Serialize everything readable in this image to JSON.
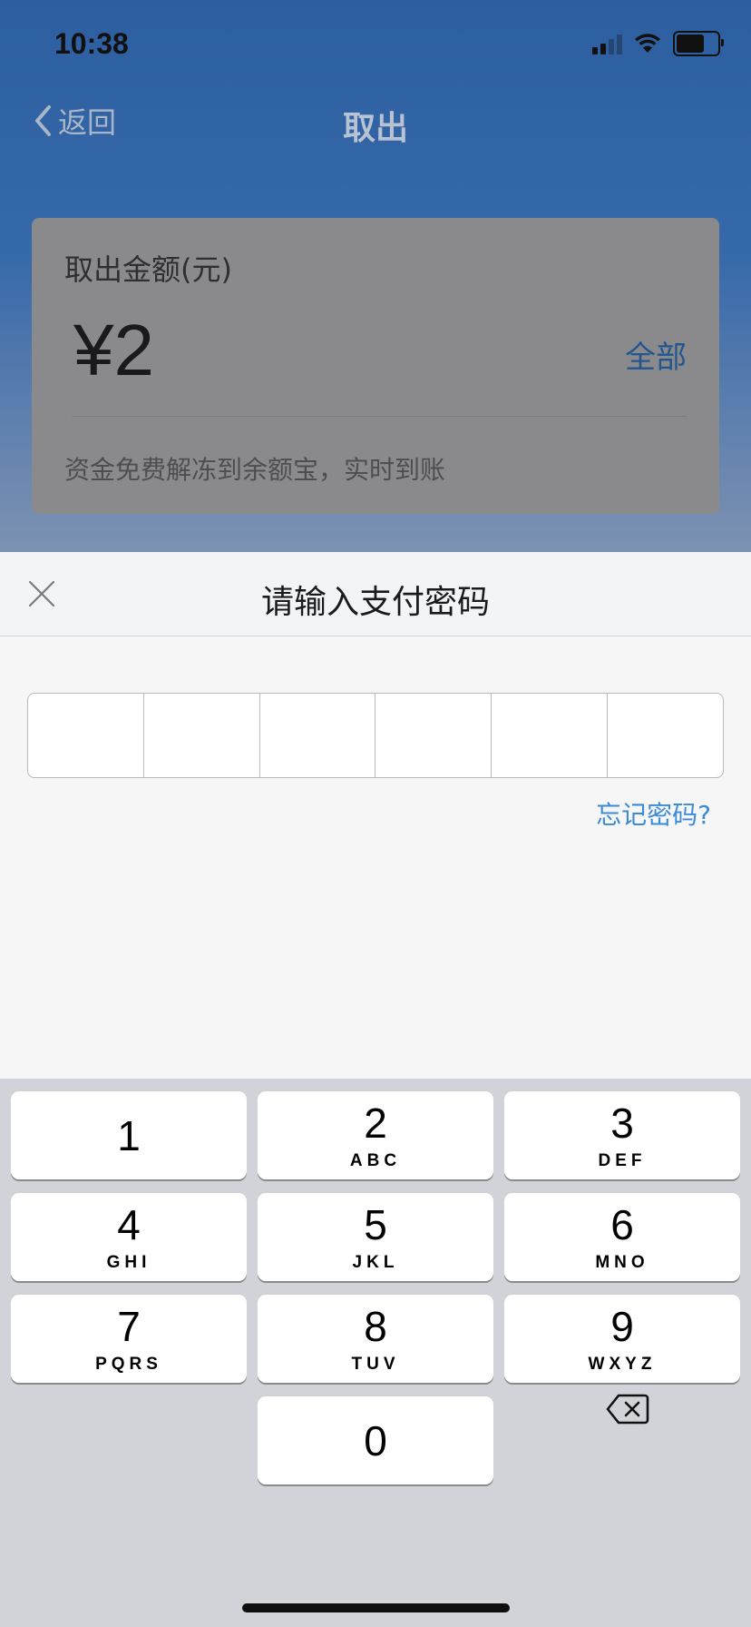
{
  "status_bar": {
    "time": "10:38"
  },
  "nav": {
    "back_label": "返回",
    "title": "取出"
  },
  "amount_card": {
    "label": "取出金额(元)",
    "value": "¥2",
    "all_label": "全部",
    "hint": "资金免费解冻到余额宝，实时到账"
  },
  "password_sheet": {
    "title": "请输入支付密码",
    "forgot_label": "忘记密码?",
    "digit_count": 6
  },
  "keypad": {
    "keys": [
      {
        "num": "1",
        "letters": ""
      },
      {
        "num": "2",
        "letters": "ABC"
      },
      {
        "num": "3",
        "letters": "DEF"
      },
      {
        "num": "4",
        "letters": "GHI"
      },
      {
        "num": "5",
        "letters": "JKL"
      },
      {
        "num": "6",
        "letters": "MNO"
      },
      {
        "num": "7",
        "letters": "PQRS"
      },
      {
        "num": "8",
        "letters": "TUV"
      },
      {
        "num": "9",
        "letters": "WXYZ"
      },
      {
        "num": "0",
        "letters": ""
      }
    ],
    "delete_icon": "backspace-icon"
  },
  "colors": {
    "header_blue": "#2d5fa0",
    "link_blue": "#3b8bd9",
    "keypad_bg": "#d1d3d9"
  }
}
